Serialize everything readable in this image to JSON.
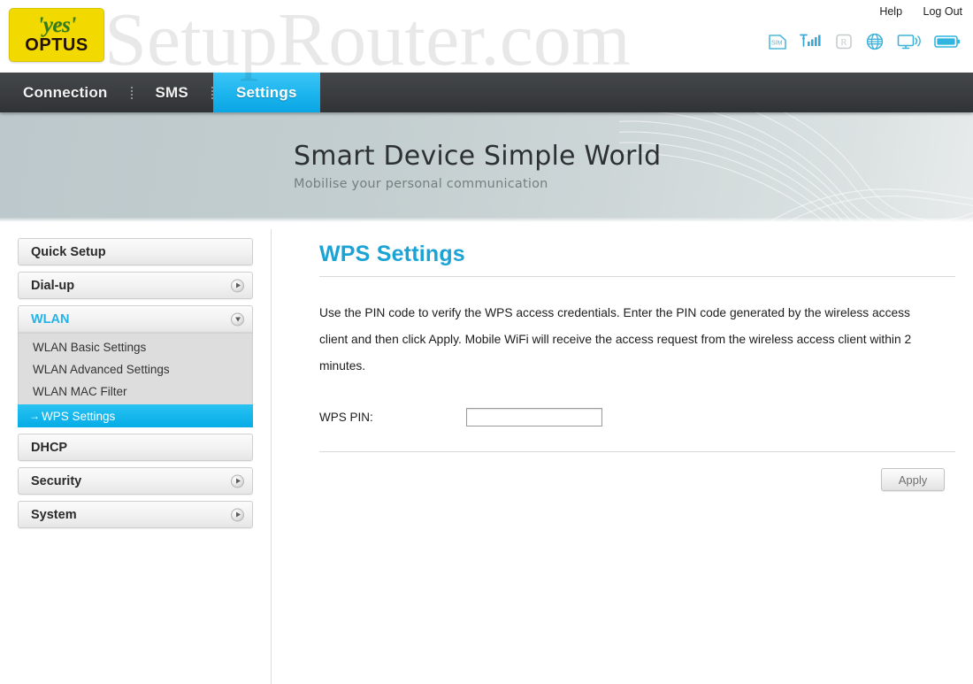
{
  "brand": {
    "logo_yes": "'yes'",
    "logo_optus": "OPTUS",
    "logo_bg_color": "#F2D900",
    "logo_yes_color": "#2f7d1f",
    "logo_optus_color": "#231209"
  },
  "watermark": {
    "text": "SetupRouter.com"
  },
  "header": {
    "help_label": "Help",
    "logout_label": "Log Out",
    "status_icons": [
      {
        "name": "sim-card-icon",
        "label": "SIM",
        "state": "active",
        "color": "#3fb8de"
      },
      {
        "name": "signal-strength-icon",
        "label": "Signal",
        "state": "active",
        "bars": 4,
        "color": "#3fb8de"
      },
      {
        "name": "roaming-icon",
        "label": "R",
        "state": "inactive",
        "color": "#c3c9cb"
      },
      {
        "name": "globe-icon",
        "label": "Internet",
        "state": "active",
        "color": "#3fb8de"
      },
      {
        "name": "wifi-monitor-icon",
        "label": "WiFi Clients",
        "state": "active",
        "color": "#3fb8de"
      },
      {
        "name": "battery-icon",
        "label": "Battery",
        "state": "active",
        "color": "#2fb5e0"
      }
    ]
  },
  "nav": {
    "items": [
      {
        "label": "Connection",
        "active": false
      },
      {
        "label": "SMS",
        "active": false
      },
      {
        "label": "Settings",
        "active": true
      }
    ],
    "active_color": "#1fb6ef",
    "bar_color": "#3a3d3f"
  },
  "banner": {
    "title": "Smart Device  Simple World",
    "subtitle": "Mobilise your personal communication"
  },
  "sidebar": {
    "items": [
      {
        "label": "Quick Setup",
        "expandable": false,
        "expanded": false,
        "active": false
      },
      {
        "label": "Dial-up",
        "expandable": true,
        "expanded": false,
        "active": false
      },
      {
        "label": "WLAN",
        "expandable": true,
        "expanded": true,
        "active": true,
        "children": [
          {
            "label": "WLAN Basic Settings",
            "active": false
          },
          {
            "label": "WLAN Advanced Settings",
            "active": false
          },
          {
            "label": "WLAN MAC Filter",
            "active": false
          },
          {
            "label": "WPS Settings",
            "active": true,
            "arrow": "→"
          }
        ]
      },
      {
        "label": "DHCP",
        "expandable": false,
        "expanded": false,
        "active": false
      },
      {
        "label": "Security",
        "expandable": true,
        "expanded": false,
        "active": false
      },
      {
        "label": "System",
        "expandable": true,
        "expanded": false,
        "active": false
      }
    ],
    "active_color": "#16b7ec"
  },
  "main": {
    "page_title": "WPS Settings",
    "description": "Use the PIN code to verify the WPS access credentials. Enter the PIN code generated by the wireless access client and then click Apply. Mobile WiFi will receive the access request from the wireless access client within 2 minutes.",
    "form": {
      "wps_pin_label": "WPS PIN:",
      "wps_pin_value": "",
      "wps_pin_placeholder": ""
    },
    "apply_label": "Apply",
    "title_color": "#1ba3d6"
  }
}
